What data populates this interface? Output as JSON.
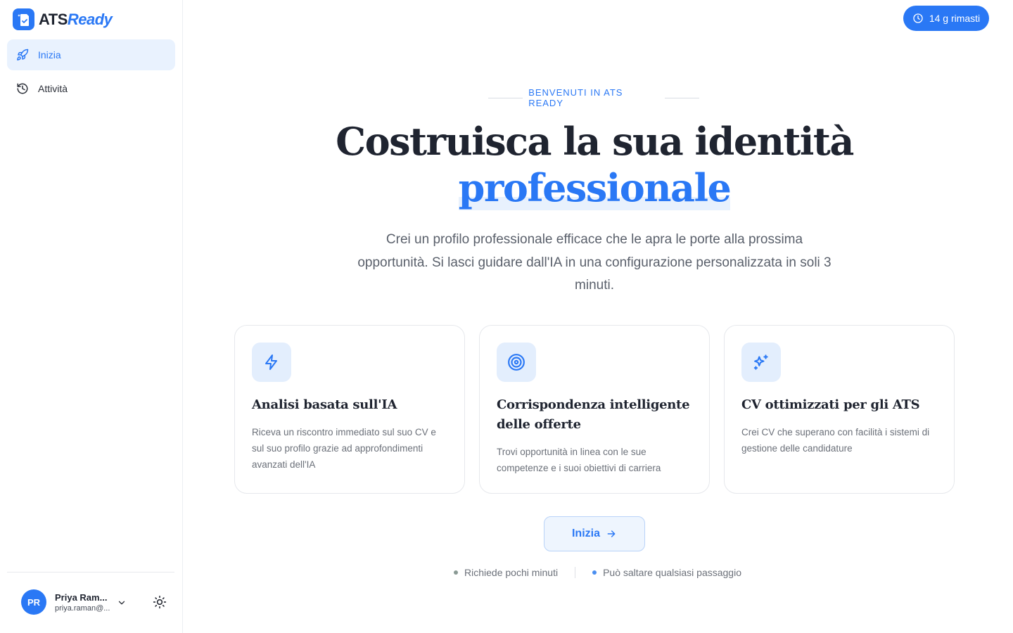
{
  "app": {
    "brand_part1": "ATS",
    "brand_part2": "Ready"
  },
  "sidebar": {
    "items": [
      {
        "label": "Inizia",
        "icon": "rocket-icon",
        "active": true
      },
      {
        "label": "Attività",
        "icon": "history-icon",
        "active": false
      }
    ]
  },
  "user": {
    "initials": "PR",
    "name": "Priya Ram...",
    "email": "priya.raman@..."
  },
  "trial": {
    "label": "14 g rimasti"
  },
  "hero": {
    "eyebrow": "BENVENUTI IN ATS READY",
    "headline_line1": "Costruisca la sua identità",
    "headline_accent": "professionale",
    "subtitle": "Crei un profilo professionale efficace che le apra le porte alla prossima opportunità. Si lasci guidare dall'IA in una configurazione personalizzata in soli 3 minuti."
  },
  "features": [
    {
      "icon": "lightning-icon",
      "title": "Analisi basata sull'IA",
      "description": "Riceva un riscontro immediato sul suo CV e sul suo profilo grazie ad approfondimenti avanzati dell'IA"
    },
    {
      "icon": "target-icon",
      "title": "Corrispondenza intelligente delle offerte",
      "description": "Trovi opportunità in linea con le sue competenze e i suoi obiettivi di carriera"
    },
    {
      "icon": "sparkles-icon",
      "title": "CV ottimizzati per gli ATS",
      "description": "Crei CV che superano con facilità i sistemi di gestione delle candidature"
    }
  ],
  "cta": {
    "label": "Inizia"
  },
  "notes": [
    {
      "text": "Richiede pochi minuti",
      "dot_color": "#8a9a94"
    },
    {
      "text": "Può saltare qualsiasi passaggio",
      "dot_color": "#4a8ef0"
    }
  ],
  "colors": {
    "accent": "#2a78f5",
    "accent_soft": "#e9f2fe"
  }
}
